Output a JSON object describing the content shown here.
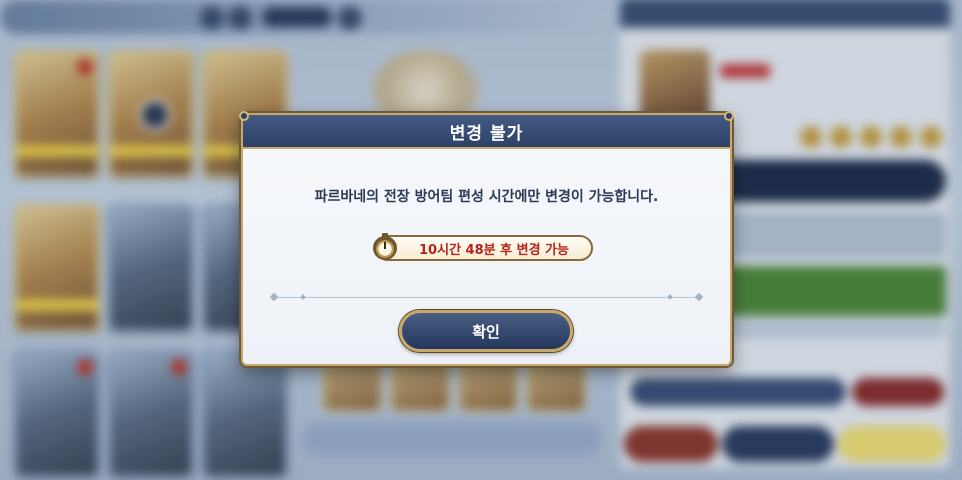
{
  "modal": {
    "title": "변경 불가",
    "message": "파르바네의 전장 방어팀 편성 시간에만 변경이 가능합니다.",
    "timer_text": "10시간 48분 후 변경 가능",
    "timer_icon": "stopwatch-icon",
    "confirm_label": "확인"
  },
  "colors": {
    "header": "#2d4168",
    "accent_gold": "#c9a86a",
    "timer_text": "#b3261e",
    "message_text": "#2c3a55"
  }
}
